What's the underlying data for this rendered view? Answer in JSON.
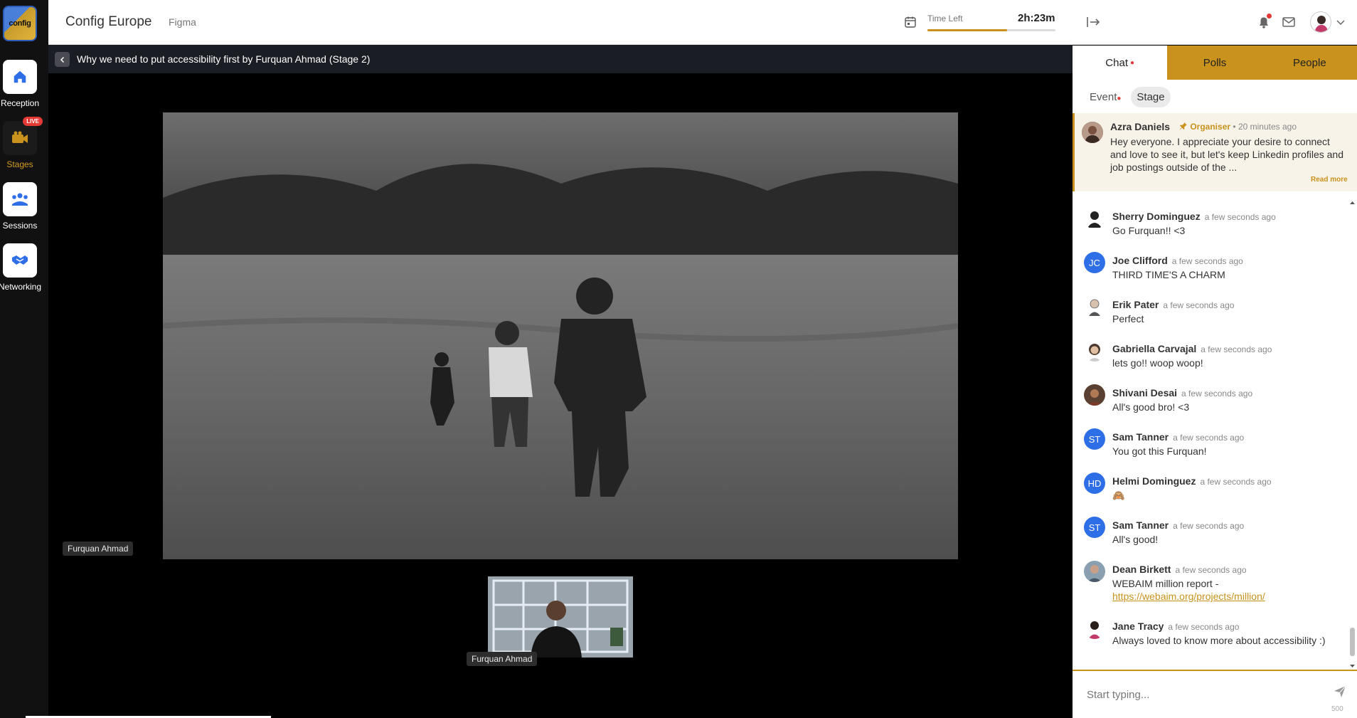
{
  "header": {
    "event_title": "Config Europe",
    "org_name": "Figma",
    "time_left_label": "Time Left",
    "time_left_value": "2h:23m",
    "time_left_progress": 0.62
  },
  "logo": {
    "text": "config"
  },
  "rail": {
    "items": [
      {
        "label": "Reception",
        "icon": "home-icon"
      },
      {
        "label": "Stages",
        "icon": "camera-icon",
        "badge": "LIVE"
      },
      {
        "label": "Sessions",
        "icon": "group-icon"
      },
      {
        "label": "Networking",
        "icon": "handshake-icon"
      }
    ]
  },
  "stage": {
    "title": "Why we need to put accessibility first by Furquan Ahmad (Stage 2)",
    "speaker_tag_main": "Furquan Ahmad",
    "speaker_tag_cam": "Furquan Ahmad"
  },
  "tabs": {
    "chat": "Chat",
    "polls": "Polls",
    "people": "People"
  },
  "subtabs": {
    "event": "Event",
    "stage": "Stage"
  },
  "pinned": {
    "name": "Azra Daniels",
    "role": "Organiser",
    "separator": "•",
    "time": "20 minutes ago",
    "text": "Hey everyone. I appreciate your desire to connect and love to see it, but let's keep Linkedin profiles and job postings outside of the ...",
    "read_more": "Read more"
  },
  "messages": [
    {
      "name": "Sherry Dominguez",
      "time": "a few seconds ago",
      "text": "Go Furquan!! <3",
      "avatar": "photo"
    },
    {
      "name": "Joe Clifford",
      "time": "a few seconds ago",
      "text": "THIRD TIME'S A CHARM",
      "initials": "JC"
    },
    {
      "name": "Erik Pater",
      "time": "a few seconds ago",
      "text": "Perfect",
      "avatar": "photo"
    },
    {
      "name": "Gabriella Carvajal",
      "time": "a few seconds ago",
      "text": "lets go!! woop woop!",
      "avatar": "photo"
    },
    {
      "name": "Shivani Desai",
      "time": "a few seconds ago",
      "text": "All's good bro! <3",
      "avatar": "photo"
    },
    {
      "name": "Sam Tanner",
      "time": "a few seconds ago",
      "text": "You got this Furquan!",
      "initials": "ST"
    },
    {
      "name": "Helmi Dominguez",
      "time": "a few seconds ago",
      "text": "🙈",
      "initials": "HD"
    },
    {
      "name": "Sam Tanner",
      "time": "a few seconds ago",
      "text": "All's good!",
      "initials": "ST"
    },
    {
      "name": "Dean Birkett",
      "time": "a few seconds ago",
      "text": "WEBAIM million report -",
      "link": "https://webaim.org/projects/million/",
      "avatar": "photo"
    },
    {
      "name": "Jane Tracy",
      "time": "a few seconds ago",
      "text": "Always loved to know more about accessibility :)",
      "avatar": "photo"
    }
  ],
  "input": {
    "placeholder": "Start typing...",
    "char_count": "500"
  },
  "colors": {
    "accent": "#c8921d",
    "notification": "#e53935",
    "initials_avatar": "#2e6ee6"
  }
}
